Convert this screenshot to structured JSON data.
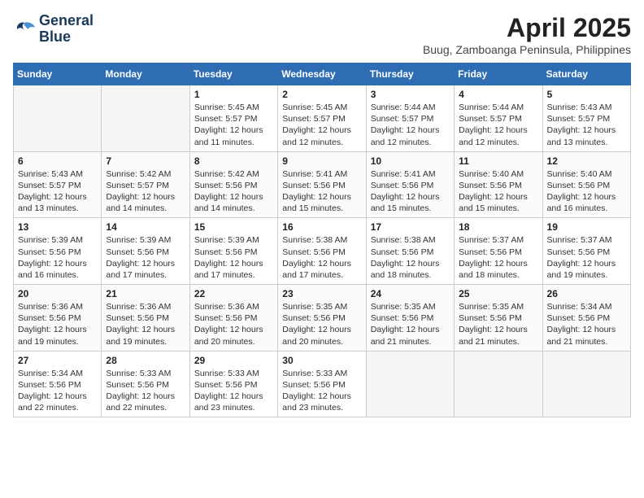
{
  "logo": {
    "line1": "General",
    "line2": "Blue"
  },
  "title": "April 2025",
  "subtitle": "Buug, Zamboanga Peninsula, Philippines",
  "weekdays": [
    "Sunday",
    "Monday",
    "Tuesday",
    "Wednesday",
    "Thursday",
    "Friday",
    "Saturday"
  ],
  "weeks": [
    [
      {
        "day": null
      },
      {
        "day": null
      },
      {
        "day": 1,
        "sunrise": "5:45 AM",
        "sunset": "5:57 PM",
        "daylight": "12 hours and 11 minutes."
      },
      {
        "day": 2,
        "sunrise": "5:45 AM",
        "sunset": "5:57 PM",
        "daylight": "12 hours and 12 minutes."
      },
      {
        "day": 3,
        "sunrise": "5:44 AM",
        "sunset": "5:57 PM",
        "daylight": "12 hours and 12 minutes."
      },
      {
        "day": 4,
        "sunrise": "5:44 AM",
        "sunset": "5:57 PM",
        "daylight": "12 hours and 12 minutes."
      },
      {
        "day": 5,
        "sunrise": "5:43 AM",
        "sunset": "5:57 PM",
        "daylight": "12 hours and 13 minutes."
      }
    ],
    [
      {
        "day": 6,
        "sunrise": "5:43 AM",
        "sunset": "5:57 PM",
        "daylight": "12 hours and 13 minutes."
      },
      {
        "day": 7,
        "sunrise": "5:42 AM",
        "sunset": "5:57 PM",
        "daylight": "12 hours and 14 minutes."
      },
      {
        "day": 8,
        "sunrise": "5:42 AM",
        "sunset": "5:56 PM",
        "daylight": "12 hours and 14 minutes."
      },
      {
        "day": 9,
        "sunrise": "5:41 AM",
        "sunset": "5:56 PM",
        "daylight": "12 hours and 15 minutes."
      },
      {
        "day": 10,
        "sunrise": "5:41 AM",
        "sunset": "5:56 PM",
        "daylight": "12 hours and 15 minutes."
      },
      {
        "day": 11,
        "sunrise": "5:40 AM",
        "sunset": "5:56 PM",
        "daylight": "12 hours and 15 minutes."
      },
      {
        "day": 12,
        "sunrise": "5:40 AM",
        "sunset": "5:56 PM",
        "daylight": "12 hours and 16 minutes."
      }
    ],
    [
      {
        "day": 13,
        "sunrise": "5:39 AM",
        "sunset": "5:56 PM",
        "daylight": "12 hours and 16 minutes."
      },
      {
        "day": 14,
        "sunrise": "5:39 AM",
        "sunset": "5:56 PM",
        "daylight": "12 hours and 17 minutes."
      },
      {
        "day": 15,
        "sunrise": "5:39 AM",
        "sunset": "5:56 PM",
        "daylight": "12 hours and 17 minutes."
      },
      {
        "day": 16,
        "sunrise": "5:38 AM",
        "sunset": "5:56 PM",
        "daylight": "12 hours and 17 minutes."
      },
      {
        "day": 17,
        "sunrise": "5:38 AM",
        "sunset": "5:56 PM",
        "daylight": "12 hours and 18 minutes."
      },
      {
        "day": 18,
        "sunrise": "5:37 AM",
        "sunset": "5:56 PM",
        "daylight": "12 hours and 18 minutes."
      },
      {
        "day": 19,
        "sunrise": "5:37 AM",
        "sunset": "5:56 PM",
        "daylight": "12 hours and 19 minutes."
      }
    ],
    [
      {
        "day": 20,
        "sunrise": "5:36 AM",
        "sunset": "5:56 PM",
        "daylight": "12 hours and 19 minutes."
      },
      {
        "day": 21,
        "sunrise": "5:36 AM",
        "sunset": "5:56 PM",
        "daylight": "12 hours and 19 minutes."
      },
      {
        "day": 22,
        "sunrise": "5:36 AM",
        "sunset": "5:56 PM",
        "daylight": "12 hours and 20 minutes."
      },
      {
        "day": 23,
        "sunrise": "5:35 AM",
        "sunset": "5:56 PM",
        "daylight": "12 hours and 20 minutes."
      },
      {
        "day": 24,
        "sunrise": "5:35 AM",
        "sunset": "5:56 PM",
        "daylight": "12 hours and 21 minutes."
      },
      {
        "day": 25,
        "sunrise": "5:35 AM",
        "sunset": "5:56 PM",
        "daylight": "12 hours and 21 minutes."
      },
      {
        "day": 26,
        "sunrise": "5:34 AM",
        "sunset": "5:56 PM",
        "daylight": "12 hours and 21 minutes."
      }
    ],
    [
      {
        "day": 27,
        "sunrise": "5:34 AM",
        "sunset": "5:56 PM",
        "daylight": "12 hours and 22 minutes."
      },
      {
        "day": 28,
        "sunrise": "5:33 AM",
        "sunset": "5:56 PM",
        "daylight": "12 hours and 22 minutes."
      },
      {
        "day": 29,
        "sunrise": "5:33 AM",
        "sunset": "5:56 PM",
        "daylight": "12 hours and 23 minutes."
      },
      {
        "day": 30,
        "sunrise": "5:33 AM",
        "sunset": "5:56 PM",
        "daylight": "12 hours and 23 minutes."
      },
      {
        "day": null
      },
      {
        "day": null
      },
      {
        "day": null
      }
    ]
  ]
}
